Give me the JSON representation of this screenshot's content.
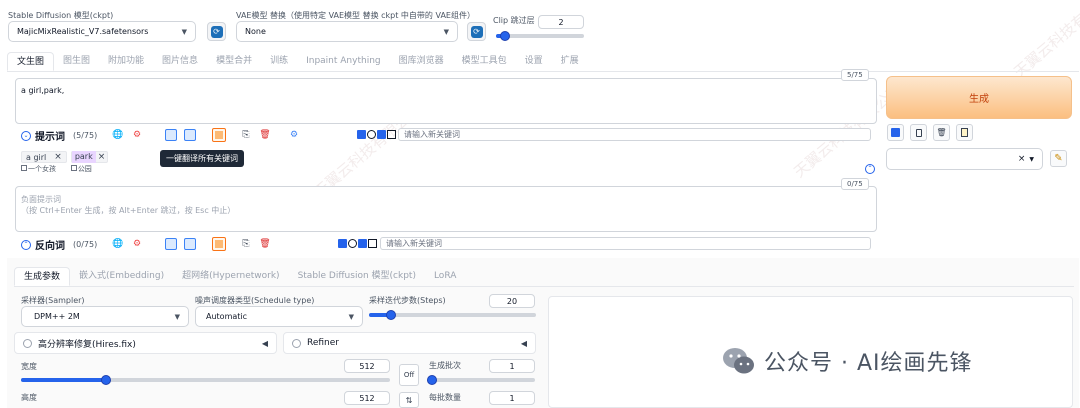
{
  "top": {
    "ckpt_label": "Stable Diffusion 模型(ckpt)",
    "ckpt_value": "MajicMixRealistic_V7.safetensors",
    "vae_label": "VAE模型 替换（使用特定 VAE模型 替换 ckpt 中自带的 VAE组件）",
    "vae_value": "None",
    "clip_label": "Clip 跳过层",
    "clip_value": "2",
    "clip_level": 0.1
  },
  "main_tabs": [
    "文生图",
    "图生图",
    "附加功能",
    "图片信息",
    "模型合并",
    "训练",
    "Inpaint Anything",
    "图库浏览器",
    "模型工具包",
    "设置",
    "扩展"
  ],
  "prompt": {
    "text": "a girl,park,",
    "counter": "5/75",
    "section_label": "提示词",
    "section_count": "(5/75)",
    "keyword_placeholder": "请输入新关键词",
    "tooltip": "一键翻译所有关键词",
    "chips": [
      {
        "en": "a girl",
        "zh": "一个女孩"
      },
      {
        "en": "park",
        "zh": "公园"
      }
    ]
  },
  "negative": {
    "placeholder": "负面提示词\n（按 Ctrl+Enter 生成，按 Alt+Enter 跳过，按 Esc 中止）",
    "counter": "0/75",
    "section_label": "反向词",
    "section_count": "(0/75)",
    "keyword_placeholder": "请输入新关键词"
  },
  "generate_label": "生成",
  "sub_tabs": [
    "生成参数",
    "嵌入式(Embedding)",
    "超网络(Hypernetwork)",
    "Stable Diffusion 模型(ckpt)",
    "LoRA"
  ],
  "params": {
    "sampler_label": "采样器(Sampler)",
    "sampler_value": "DPM++ 2M",
    "schedule_label": "噪声调度器类型(Schedule type)",
    "schedule_value": "Automatic",
    "steps_label": "采样迭代步数(Steps)",
    "steps_value": "20",
    "steps_level": 0.13,
    "hires_label": "高分辨率修复(Hires.fix)",
    "refiner_label": "Refiner",
    "width_label": "宽度",
    "width_value": "512",
    "width_level": 0.23,
    "height_label": "高度",
    "height_value": "512",
    "off_label": "Off",
    "batch_count_label": "生成批次",
    "batch_count_value": "1",
    "batch_size_label": "每批数量",
    "batch_size_value": "1"
  },
  "brand": {
    "text": "公众号 · AI绘画先锋"
  },
  "colors": {
    "accent": "#2563eb",
    "generate": "#fbbf80",
    "chip_highlight": "#e9d5ff"
  }
}
